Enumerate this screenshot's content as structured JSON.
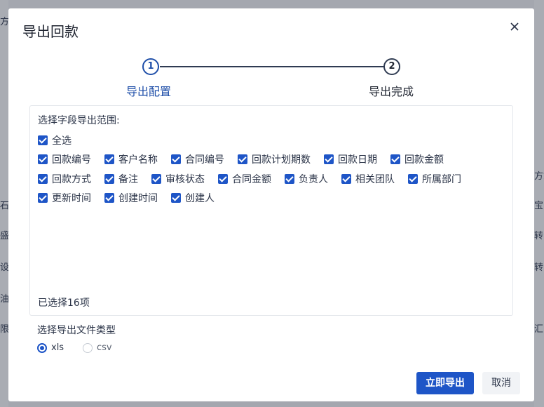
{
  "background": {
    "fragments": [
      "方",
      "石",
      "盛",
      "设",
      "油",
      "限",
      "方式",
      "宝",
      "转",
      "转",
      "汇"
    ]
  },
  "dialog": {
    "title": "导出回款",
    "steps": [
      {
        "number": "1",
        "label": "导出配置"
      },
      {
        "number": "2",
        "label": "导出完成"
      }
    ],
    "fields": {
      "title": "选择字段导出范围:",
      "select_all": "全选",
      "items": [
        "回款编号",
        "客户名称",
        "合同编号",
        "回款计划期数",
        "回款日期",
        "回款金额",
        "回款方式",
        "备注",
        "审核状态",
        "合同金额",
        "负责人",
        "相关团队",
        "所属部门",
        "更新时间",
        "创建时间",
        "创建人"
      ],
      "selected_count": "已选择16项"
    },
    "file_type": {
      "title": "选择导出文件类型",
      "options": [
        "xls",
        "csv"
      ],
      "selected": "xls"
    },
    "buttons": {
      "export": "立即导出",
      "cancel": "取消"
    }
  }
}
